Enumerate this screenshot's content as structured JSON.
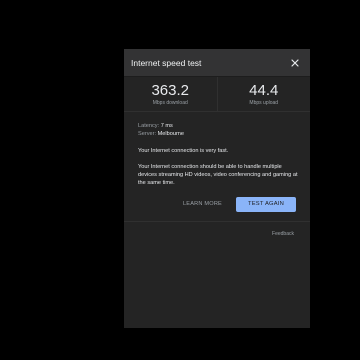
{
  "header": {
    "title": "Internet speed test",
    "close_icon": "close-icon"
  },
  "metrics": {
    "download_value": "363.2",
    "download_unit": "Mbps download",
    "upload_value": "44.4",
    "upload_unit": "Mbps upload"
  },
  "info": {
    "latency_label": "Latency:",
    "latency_value": "7 ms",
    "server_label": "Server:",
    "server_value": "Melbourne"
  },
  "messages": {
    "summary": "Your Internet connection is very fast.",
    "detail": "Your Internet connection should be able to handle multiple devices streaming HD videos, video conferencing and gaming at the same time."
  },
  "actions": {
    "learn_more": "LEARN MORE",
    "test_again": "TEST AGAIN"
  },
  "footer": {
    "feedback": "Feedback"
  },
  "colors": {
    "accent": "#8ab4f8",
    "panel_bg": "#242424",
    "header_bg": "#333334"
  }
}
